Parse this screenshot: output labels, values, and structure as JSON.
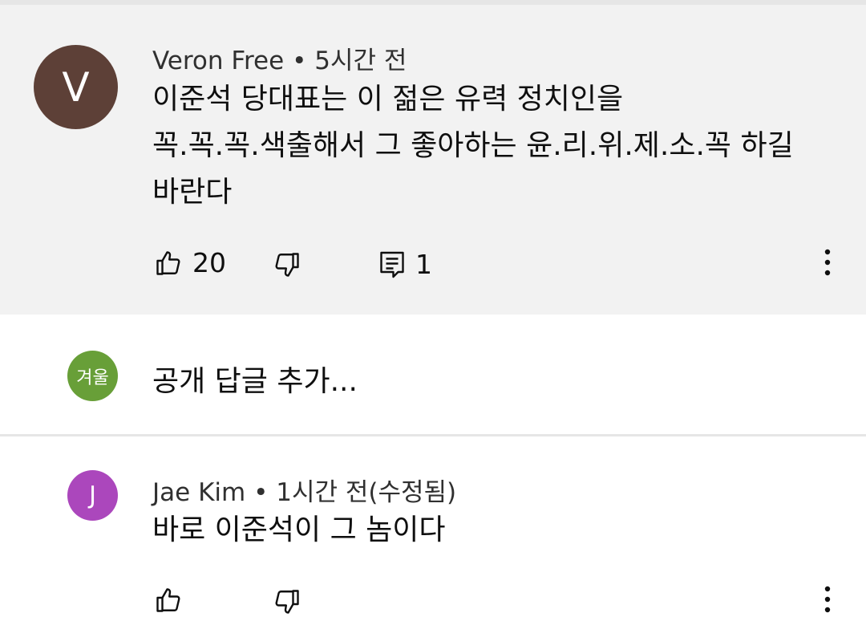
{
  "comment": {
    "avatar_letter": "V",
    "author": "Veron Free",
    "separator": "•",
    "time": "5시간 전",
    "text_lines": [
      "이준석 당대표는 이 젊은 유력 정치인을",
      "꼭.꼭.꼭.색출해서 그 좋아하는 윤.리.위.제.소.꼭 하길",
      "바란다"
    ],
    "like_count": "20",
    "reply_count": "1",
    "avatar_color": "#5d4037"
  },
  "reply_box": {
    "avatar_text": "겨울",
    "placeholder": "공개 답글 추가...",
    "avatar_color": "#689f38"
  },
  "reply": {
    "avatar_letter": "J",
    "author": "Jae Kim",
    "separator": "•",
    "time": "1시간 전(수정됨)",
    "text": "바로 이준석이 그 놈이다",
    "avatar_color": "#ab47bc"
  },
  "icons": {
    "like": "thumbs-up-icon",
    "dislike": "thumbs-down-icon",
    "reply": "comment-reply-icon",
    "more": "more-vert-icon"
  }
}
